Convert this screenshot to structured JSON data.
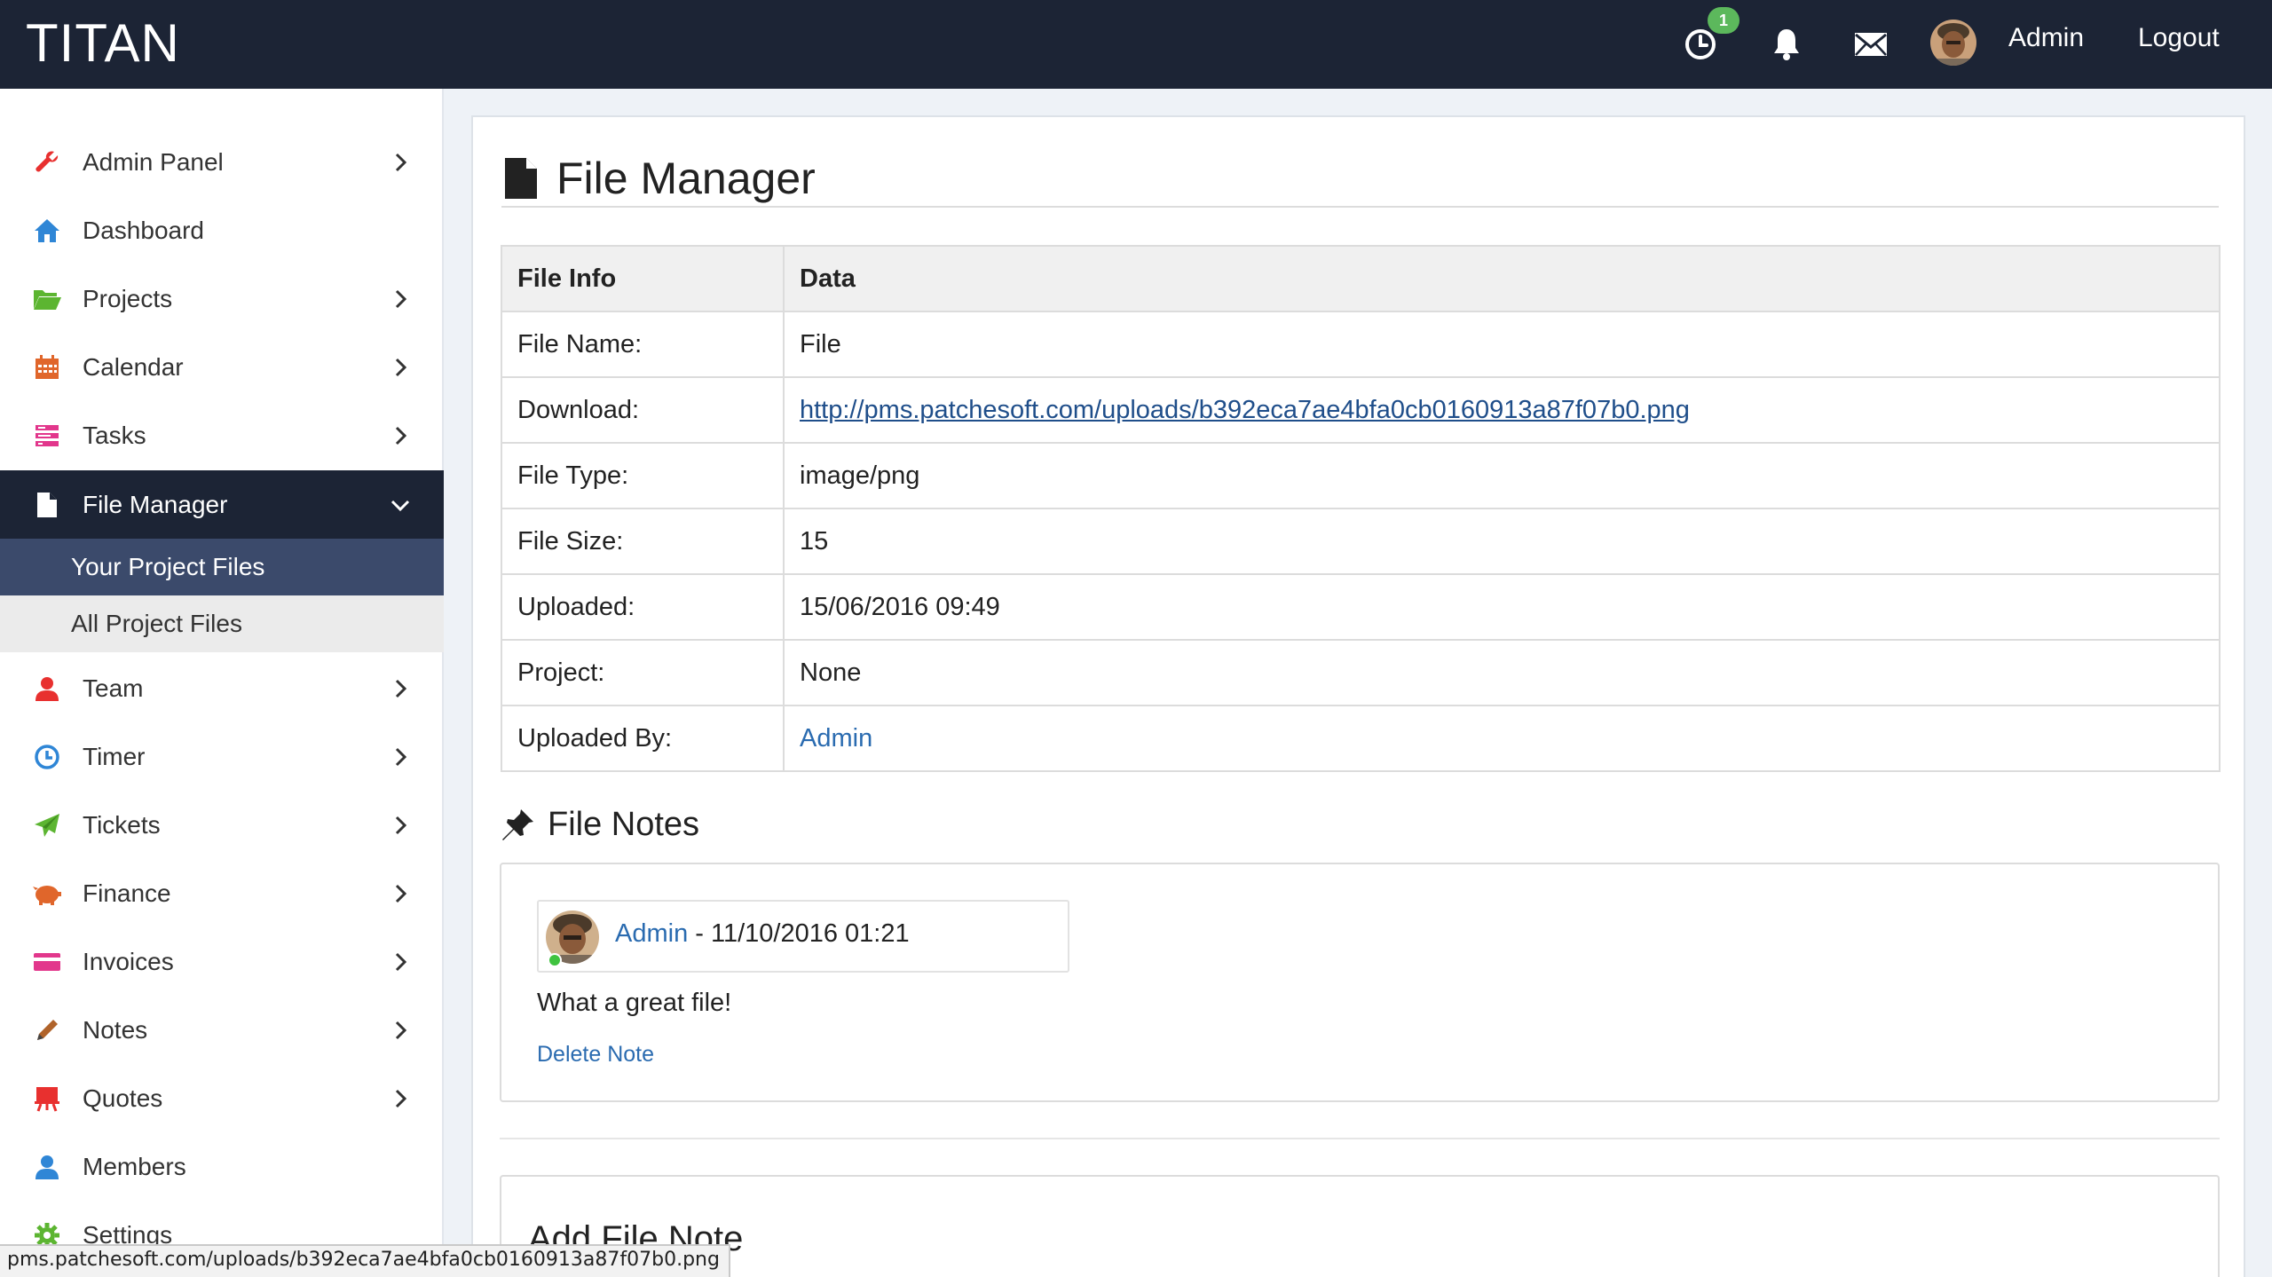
{
  "app": {
    "brand": "TITAN"
  },
  "topbar": {
    "timer_badge": "1",
    "user_name": "Admin",
    "logout_label": "Logout"
  },
  "colors": {
    "topbar_bg": "#1c2435",
    "active_nav_bg": "#1c2435",
    "selected_sub_bg": "#3b4a6b",
    "link": "#2a6bb0",
    "badge": "#5cb85c"
  },
  "sidebar": {
    "items": [
      {
        "label": "Admin Panel",
        "icon": "wrench-icon",
        "color": "#e8302f",
        "has_chevron": true
      },
      {
        "label": "Dashboard",
        "icon": "home-icon",
        "color": "#2f86d6",
        "has_chevron": false
      },
      {
        "label": "Projects",
        "icon": "folder-open-icon",
        "color": "#5cb531",
        "has_chevron": true
      },
      {
        "label": "Calendar",
        "icon": "calendar-icon",
        "color": "#e0662b",
        "has_chevron": true
      },
      {
        "label": "Tasks",
        "icon": "tasks-icon",
        "color": "#e2378c",
        "has_chevron": true
      },
      {
        "label": "File Manager",
        "icon": "file-icon",
        "color": "#ffffff",
        "has_chevron": true,
        "active": true
      },
      {
        "label": "Team",
        "icon": "user-icon",
        "color": "#e8302f",
        "has_chevron": true
      },
      {
        "label": "Timer",
        "icon": "clock-icon",
        "color": "#2f86d6",
        "has_chevron": true
      },
      {
        "label": "Tickets",
        "icon": "paper-plane-icon",
        "color": "#5cb531",
        "has_chevron": true
      },
      {
        "label": "Finance",
        "icon": "piggy-bank-icon",
        "color": "#e0662b",
        "has_chevron": true
      },
      {
        "label": "Invoices",
        "icon": "credit-card-icon",
        "color": "#e2378c",
        "has_chevron": true
      },
      {
        "label": "Notes",
        "icon": "pencil-icon",
        "color": "#b0632a",
        "has_chevron": true
      },
      {
        "label": "Quotes",
        "icon": "easel-icon",
        "color": "#e8302f",
        "has_chevron": true
      },
      {
        "label": "Members",
        "icon": "user-icon",
        "color": "#2f86d6",
        "has_chevron": false
      },
      {
        "label": "Settings",
        "icon": "gear-icon",
        "color": "#5cb531",
        "has_chevron": false
      }
    ],
    "subitems": [
      {
        "label": "Your Project Files",
        "selected": true
      },
      {
        "label": "All Project Files",
        "selected": false
      }
    ]
  },
  "page": {
    "title": "File Manager",
    "table": {
      "headers": [
        "File Info",
        "Data"
      ],
      "rows": [
        {
          "key": "File Name:",
          "value": "File"
        },
        {
          "key": "Download:",
          "value": "http://pms.patchesoft.com/uploads/b392eca7ae4bfa0cb0160913a87f07b0.png"
        },
        {
          "key": "File Type:",
          "value": "image/png"
        },
        {
          "key": "File Size:",
          "value": "15"
        },
        {
          "key": "Uploaded:",
          "value": "15/06/2016 09:49"
        },
        {
          "key": "Project:",
          "value": "None"
        },
        {
          "key": "Uploaded By:",
          "value": "Admin"
        }
      ]
    },
    "notes_title": "File Notes",
    "note": {
      "author": "Admin",
      "separator_date": " - 11/10/2016 01:21",
      "text": "What a great file!",
      "delete_label": "Delete Note"
    },
    "add_note_title": "Add File Note"
  },
  "status_bar": {
    "url": "pms.patchesoft.com/uploads/b392eca7ae4bfa0cb0160913a87f07b0.png"
  }
}
